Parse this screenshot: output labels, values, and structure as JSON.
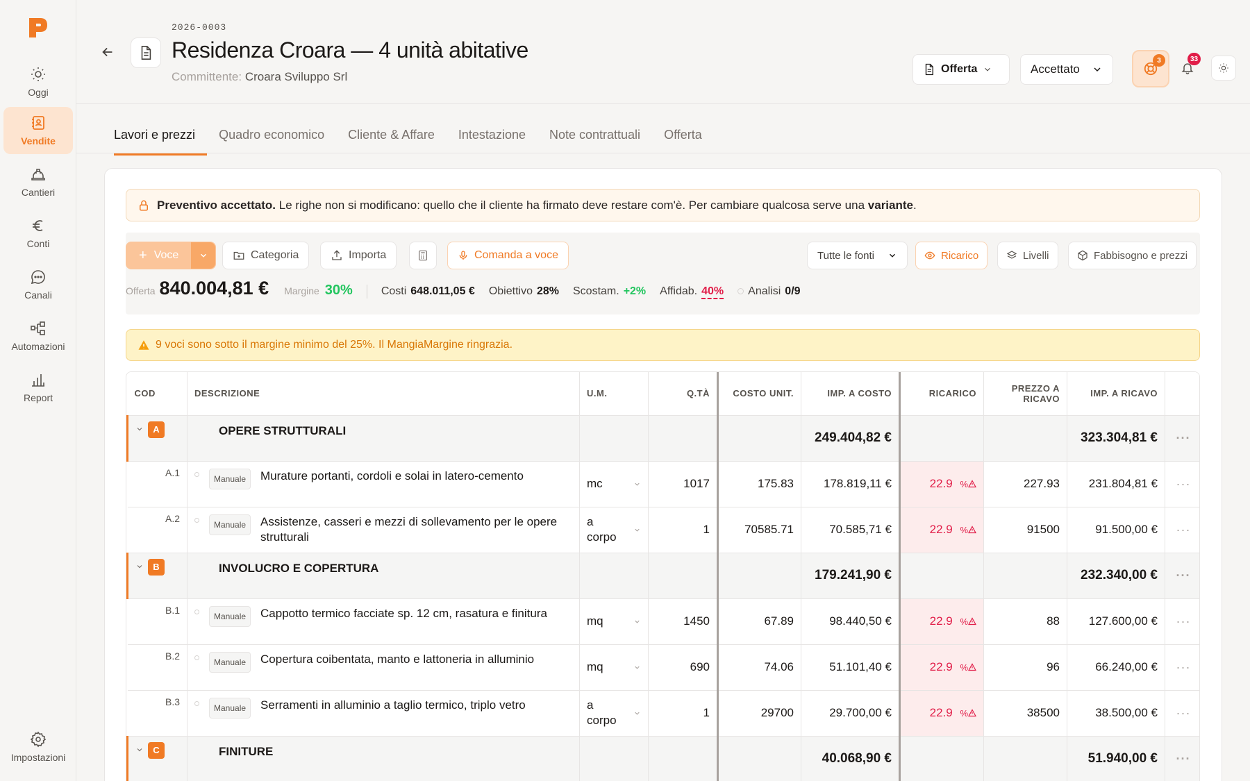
{
  "sidebar": {
    "items": [
      {
        "label": "Oggi",
        "icon": "sun-icon"
      },
      {
        "label": "Vendite",
        "icon": "contact-book-icon",
        "active": true
      },
      {
        "label": "Cantieri",
        "icon": "hard-hat-icon"
      },
      {
        "label": "Conti",
        "icon": "euro-icon"
      },
      {
        "label": "Canali",
        "icon": "chat-bubble-icon"
      },
      {
        "label": "Automazioni",
        "icon": "workflow-icon"
      },
      {
        "label": "Report",
        "icon": "bar-chart-icon"
      }
    ],
    "settings_label": "Impostazioni"
  },
  "header": {
    "code": "2026-0003",
    "title": "Residenza Croara — 4 unità abitative",
    "committente_label": "Committente:",
    "committente_value": "Croara Sviluppo Srl",
    "offerta_label": "Offerta",
    "status_label": "Accettato",
    "support_badge": "3",
    "notifications_badge": "33"
  },
  "tabs": [
    "Lavori e prezzi",
    "Quadro economico",
    "Cliente & Affare",
    "Intestazione",
    "Note contrattuali",
    "Offerta"
  ],
  "locked_alert": {
    "bold": "Preventivo accettato.",
    "text": " Le righe non si modificano: quello che il cliente ha firmato deve restare com'è. Per cambiare qualcosa serve una ",
    "bold2": "variante",
    "end": "."
  },
  "toolbar": {
    "voce": "Voce",
    "categoria": "Categoria",
    "importa": "Importa",
    "comanda": "Comanda a voce",
    "fonti": "Tutte le fonti",
    "ricarico": "Ricarico",
    "livelli": "Livelli",
    "fabbisogno": "Fabbisogno e prezzi"
  },
  "stats": {
    "offerta_label": "Offerta",
    "offerta_value": "840.004,81 €",
    "margine_label": "Margine",
    "margine_value": "30%",
    "costi_label": "Costi",
    "costi_value": "648.011,05 €",
    "obiettivo_label": "Obiettivo",
    "obiettivo_value": "28%",
    "scostam_label": "Scostam.",
    "scostam_value": "+2%",
    "affidab_label": "Affidab.",
    "affidab_value": "40%",
    "analisi_label": "Analisi",
    "analisi_value": "0/9"
  },
  "warning": "9 voci sono sotto il margine minimo del 25%. Il MangiaMargine ringrazia.",
  "table": {
    "headers": {
      "cod": "COD",
      "descrizione": "DESCRIZIONE",
      "um": "U.M.",
      "qta": "Q.TÀ",
      "costo_unit": "COSTO UNIT.",
      "imp_costo": "IMP. A COSTO",
      "ricarico": "RICARICO",
      "prezzo_ricavo_1": "PREZZO A",
      "prezzo_ricavo_2": "RICAVO",
      "imp_ricavo": "IMP. A RICAVO"
    },
    "manual_label": "Manuale",
    "ricarico_unit": "%",
    "rows": [
      {
        "type": "group",
        "letter": "A",
        "title": "OPERE STRUTTURALI",
        "imp_costo": "249.404,82 €",
        "imp_ricavo": "323.304,81 €"
      },
      {
        "type": "item",
        "cod": "A.1",
        "desc": "Murature portanti, cordoli e solai in latero-cemento",
        "um": "mc",
        "qta": "1017",
        "costo_unit": "175.83",
        "imp_costo": "178.819,11 €",
        "ricarico": "22.9",
        "prezzo": "227.93",
        "imp_ricavo": "231.804,81 €"
      },
      {
        "type": "item",
        "cod": "A.2",
        "desc": "Assistenze, casseri e mezzi di sollevamento per le opere strutturali",
        "um": "a corpo",
        "qta": "1",
        "costo_unit": "70585.71",
        "imp_costo": "70.585,71 €",
        "ricarico": "22.9",
        "prezzo": "91500",
        "imp_ricavo": "91.500,00 €"
      },
      {
        "type": "group",
        "letter": "B",
        "title": "INVOLUCRO E COPERTURA",
        "imp_costo": "179.241,90 €",
        "imp_ricavo": "232.340,00 €"
      },
      {
        "type": "item",
        "cod": "B.1",
        "desc": "Cappotto termico facciate sp. 12 cm, rasatura e finitura",
        "um": "mq",
        "qta": "1450",
        "costo_unit": "67.89",
        "imp_costo": "98.440,50 €",
        "ricarico": "22.9",
        "prezzo": "88",
        "imp_ricavo": "127.600,00 €"
      },
      {
        "type": "item",
        "cod": "B.2",
        "desc": "Copertura coibentata, manto e lattoneria in alluminio",
        "um": "mq",
        "qta": "690",
        "costo_unit": "74.06",
        "imp_costo": "51.101,40 €",
        "ricarico": "22.9",
        "prezzo": "96",
        "imp_ricavo": "66.240,00 €"
      },
      {
        "type": "item",
        "cod": "B.3",
        "desc": "Serramenti in alluminio a taglio termico, triplo vetro",
        "um": "a corpo",
        "qta": "1",
        "costo_unit": "29700",
        "imp_costo": "29.700,00 €",
        "ricarico": "22.9",
        "prezzo": "38500",
        "imp_ricavo": "38.500,00 €"
      },
      {
        "type": "group",
        "letter": "C",
        "title": "FINITURE",
        "imp_costo": "40.068,90 €",
        "imp_ricavo": "51.940,00 €"
      }
    ]
  },
  "colors": {
    "accent": "#f07a24",
    "danger": "#e11d48",
    "success": "#22c55e"
  }
}
